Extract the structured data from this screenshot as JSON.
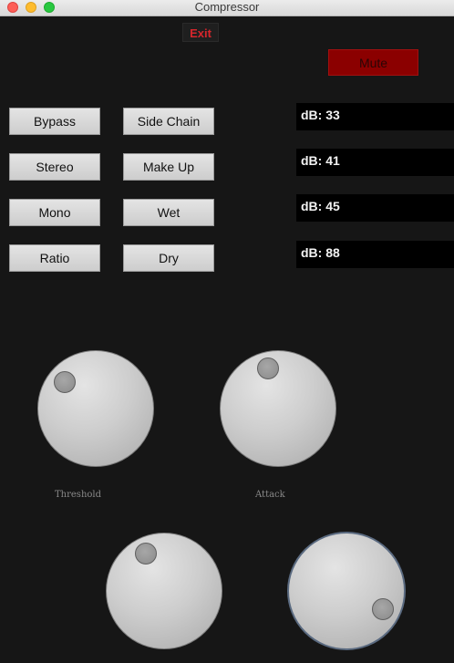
{
  "window": {
    "title": "Compressor"
  },
  "controls": {
    "exit_label": "Exit",
    "mute_label": "Mute"
  },
  "buttons": {
    "col1": [
      "Bypass",
      "Stereo",
      "Mono",
      "Ratio"
    ],
    "col2": [
      "Side Chain",
      "Make Up",
      "Wet",
      "Dry"
    ]
  },
  "db_readouts": [
    "dB: 33",
    "dB: 41",
    "dB: 45",
    "dB: 88"
  ],
  "knobs": {
    "threshold_label": "Threshold",
    "attack_label": "Attack"
  },
  "colors": {
    "background": "#161616",
    "mute": "#8b0000",
    "exit_text": "#d6262c"
  }
}
